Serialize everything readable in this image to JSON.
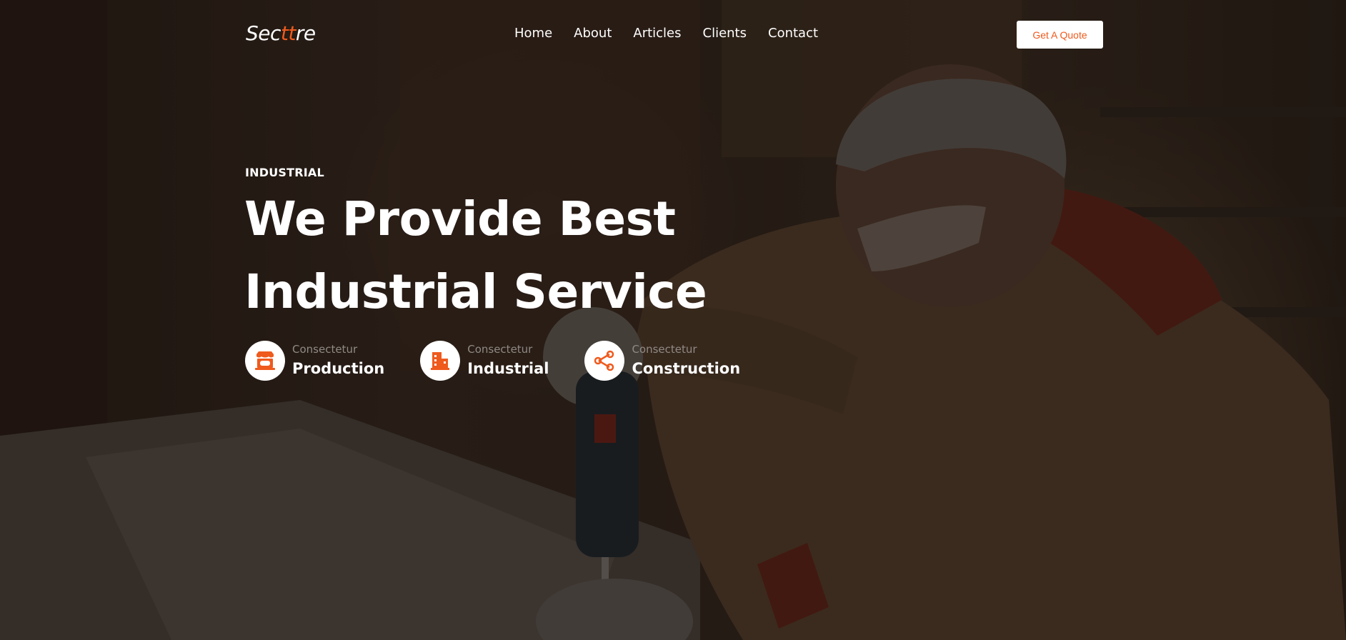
{
  "brand": {
    "logo_pre": "Sec",
    "logo_accent": "tt",
    "logo_post": "re",
    "accent_color": "#ef5a1d"
  },
  "nav": {
    "items": [
      {
        "label": "Home"
      },
      {
        "label": "About"
      },
      {
        "label": "Articles"
      },
      {
        "label": "Clients"
      },
      {
        "label": "Contact"
      }
    ]
  },
  "cta": {
    "label": "Get A Quote"
  },
  "hero": {
    "eyebrow": "INDUSTRIAL",
    "headline_line1": "We Provide Best",
    "headline_line2": "Industrial Service",
    "features": [
      {
        "icon": "storefront-icon",
        "sub": "Consectetur",
        "title": "Production"
      },
      {
        "icon": "building-icon",
        "sub": "Consectetur",
        "title": "Industrial"
      },
      {
        "icon": "share-icon",
        "sub": "Consectetur",
        "title": "Construction"
      }
    ]
  }
}
